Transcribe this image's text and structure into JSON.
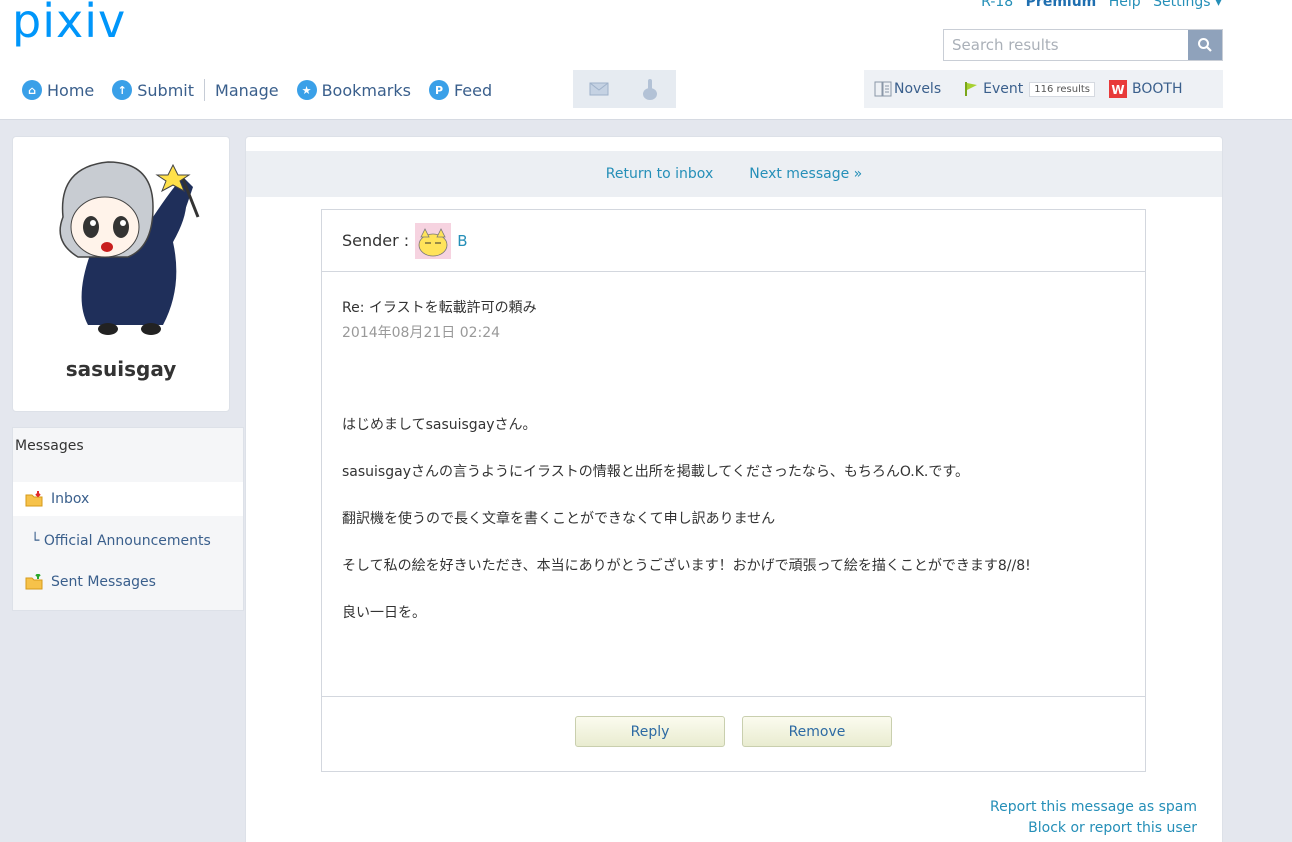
{
  "header": {
    "logo": "pixiv",
    "top_links": {
      "r18": "R-18",
      "premium": "Premium",
      "help": "Help",
      "settings": "Settings ▾"
    },
    "search": {
      "placeholder": "Search results"
    },
    "nav": {
      "home": "Home",
      "submit": "Submit",
      "manage": "Manage",
      "bookmarks": "Bookmarks",
      "feed": "Feed"
    },
    "ext": {
      "novels": "Novels",
      "event": "Event",
      "event_count": "116 results",
      "booth": "BOOTH"
    }
  },
  "sidebar": {
    "username": "sasuisgay",
    "messages_title": "Messages",
    "items": [
      {
        "label": "Inbox"
      },
      {
        "label": "└ Official Announcements"
      },
      {
        "label": "Sent Messages"
      }
    ]
  },
  "message": {
    "nav": {
      "return": "Return to inbox",
      "next": "Next message »"
    },
    "sender_label": "Sender :",
    "sender_name": "B",
    "subject": "Re: イラストを転載許可の頼み",
    "date": "2014年08月21日 02:24",
    "body": [
      "はじめましてsasuisgayさん。",
      "sasuisgayさんの言うようにイラストの情報と出所を掲載してくださったなら、もちろんO.K.です。",
      "翻訳機を使うので長く文章を書くことができなくて申し訳ありません",
      "そして私の絵を好きいただき、本当にありがとうございます！おかげで頑張って絵を描くことができます8//8!",
      "良い一日を。"
    ],
    "reply_label": "Reply",
    "remove_label": "Remove",
    "report_spam": "Report this message as spam",
    "block_user": "Block or report this user"
  },
  "colors": {
    "accent": "#0096fa",
    "link": "#258fb8",
    "background": "#e4e7ee"
  }
}
